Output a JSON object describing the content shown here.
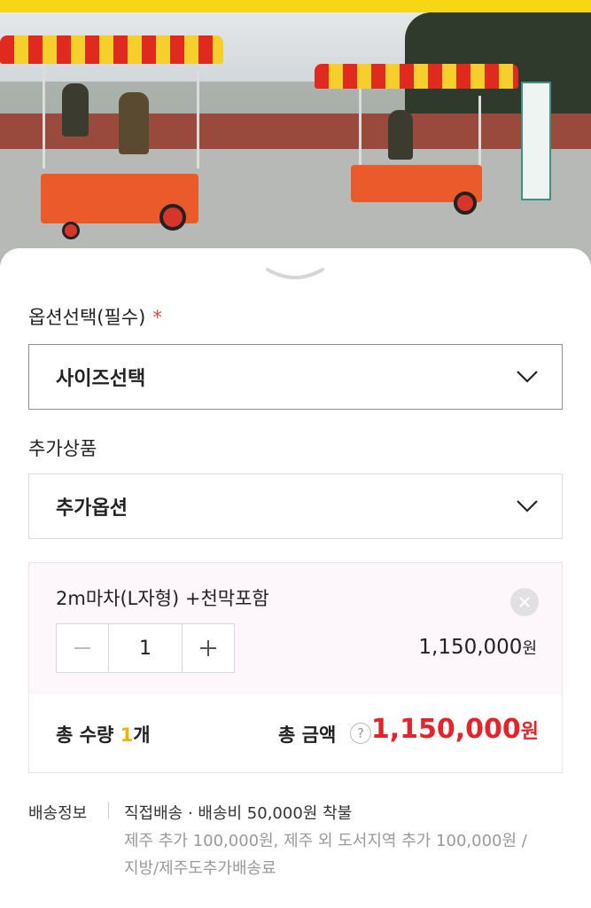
{
  "options_section": {
    "label": "옵션선택(필수)",
    "required_mark": "*",
    "size_select": {
      "value": "사이즈선택",
      "icon": "chevron-down-icon"
    }
  },
  "addon_section": {
    "label": "추가상품",
    "addon_select": {
      "value": "추가옵션",
      "icon": "chevron-down-icon"
    }
  },
  "selected_item": {
    "name": "2m마차(L자형) +천막포함",
    "quantity": "1",
    "price": "1,150,000",
    "price_unit": "원"
  },
  "summary": {
    "qty_label": "총 수량",
    "qty_value": "1",
    "qty_unit": "개",
    "total_label": "총 금액",
    "help_icon": "?",
    "total_value": "1,150,000",
    "total_unit": "원"
  },
  "shipping": {
    "label": "배송정보",
    "main": "직접배송 · 배송비 50,000원 착불",
    "note1": "제주 추가 100,000원, 제주 외 도서지역 추가 100,000원 /",
    "note2": "지방/제주도추가배송료"
  },
  "colors": {
    "accent_yellow": "#f6d615",
    "price_red": "#e2242b",
    "qty_highlight": "#f0b400",
    "required_star": "#e8463c"
  }
}
